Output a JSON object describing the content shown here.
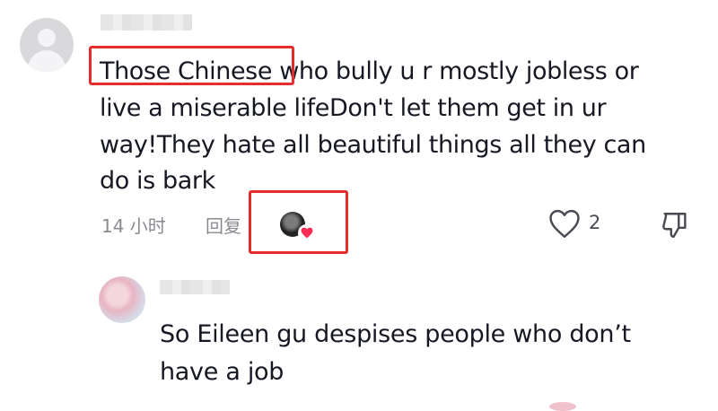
{
  "main_comment": {
    "text_lines": [
      "Those Chinese who bully u r mostly jobless or",
      "live a miserable lifeDon't let them get in ur",
      "way!They hate all beautiful things all they can",
      "do is bark"
    ],
    "time": "14 小时",
    "reply_label": "回复",
    "like_count": "2",
    "highlight_color": "#e52d2d"
  },
  "reply_comment": {
    "text_lines": [
      "So Eileen gu despises people who don’t",
      "have a job"
    ]
  },
  "icons": {
    "avatar_main": "default-avatar-icon",
    "like": "heart-outline-icon",
    "dislike": "thumbs-down-icon",
    "liker_badge": "heart-filled-icon"
  },
  "colors": {
    "text": "#161823",
    "meta": "#8a8b91",
    "heart_badge": "#fe2c55"
  }
}
